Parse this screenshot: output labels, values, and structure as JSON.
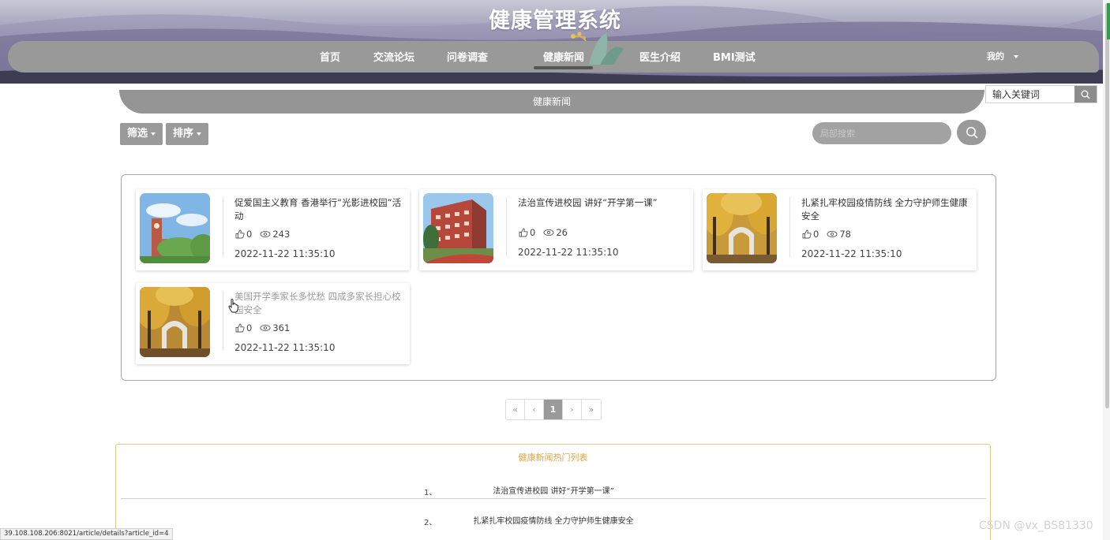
{
  "header": {
    "title": "健康管理系统",
    "nav": [
      {
        "label": "首页"
      },
      {
        "label": "交流论坛"
      },
      {
        "label": "问卷调查"
      },
      {
        "label": "健康新闻"
      },
      {
        "label": "医生介绍"
      },
      {
        "label": "BMI测试"
      }
    ],
    "active_nav": "健康新闻",
    "user_menu": "我的"
  },
  "global_search": {
    "placeholder": "输入关键词"
  },
  "section": {
    "title": "健康新闻"
  },
  "toolbar": {
    "filter_label": "筛选",
    "sort_label": "排序",
    "local_search_placeholder": "局部搜索"
  },
  "news": [
    {
      "title": "促爱国主义教育 香港举行“光影进校园”活动",
      "likes": "0",
      "views": "243",
      "date": "2022-11-22 11:35:10",
      "image": "clock-tower-campus"
    },
    {
      "title": "法治宣传进校园 讲好“开学第一课”",
      "likes": "0",
      "views": "26",
      "date": "2022-11-22 11:35:10",
      "image": "brick-building"
    },
    {
      "title": "扎紧扎牢校园疫情防线 全力守护师生健康安全",
      "likes": "0",
      "views": "78",
      "date": "2022-11-22 11:35:10",
      "image": "autumn-gate"
    },
    {
      "title": "美国开学季家长多忧愁 四成多家长担心校园安全",
      "likes": "0",
      "views": "361",
      "date": "2022-11-22 11:35:10",
      "image": "autumn-gate"
    }
  ],
  "pagination": {
    "first": "«",
    "prev": "‹",
    "current": "1",
    "next": "›",
    "last": "»"
  },
  "hot_list": {
    "title": "健康新闻热门列表",
    "items": [
      {
        "num": "1、",
        "title": "法治宣传进校园 讲好“开学第一课”"
      },
      {
        "num": "2、",
        "title": "扎紧扎牢校园疫情防线 全力守护师生健康安全"
      }
    ]
  },
  "status_bar": "39.108.108.206:8021/article/details?article_id=4",
  "watermark": "CSDN @vx_BS81330",
  "colors": {
    "nav_bg": "#999999",
    "accent": "#e2a54a",
    "button_gray": "#9a9a9a"
  }
}
